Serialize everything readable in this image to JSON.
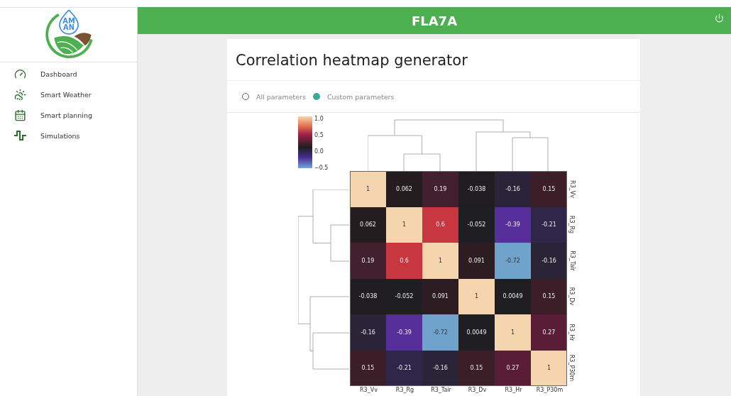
{
  "sidebar": {
    "logo": {
      "lines": [
        "AM",
        "AN"
      ]
    },
    "items": [
      {
        "label": "Dashboard"
      },
      {
        "label": "Smart Weather"
      },
      {
        "label": "Smart planning"
      },
      {
        "label": "Simulations"
      }
    ]
  },
  "header": {
    "title": "FLA7A"
  },
  "card": {
    "title": "Correlation heatmap generator",
    "options": [
      {
        "label": "All parameters",
        "selected": false
      },
      {
        "label": "Custom parameters",
        "selected": true
      }
    ],
    "heatmap": {
      "colorbar_ticks": [
        "1.0",
        "0.5",
        "0.0",
        "−0.5"
      ],
      "rows": [
        {
          "label": "R3_Vv",
          "cells": [
            {
              "text": "1",
              "color": "#f5d5ad"
            },
            {
              "text": "0.062",
              "color": "#241c1e"
            },
            {
              "text": "0.19",
              "color": "#43202e"
            },
            {
              "text": "-0.038",
              "color": "#1f1d22"
            },
            {
              "text": "-0.16",
              "color": "#2b2438"
            },
            {
              "text": "0.15",
              "color": "#3b1e27"
            }
          ]
        },
        {
          "label": "R3_Rg",
          "cells": [
            {
              "text": "0.062",
              "color": "#241c1e"
            },
            {
              "text": "1",
              "color": "#f5d5ad"
            },
            {
              "text": "0.6",
              "color": "#c8373f"
            },
            {
              "text": "-0.052",
              "color": "#1f1e23"
            },
            {
              "text": "-0.39",
              "color": "#572f9a"
            },
            {
              "text": "-0.21",
              "color": "#30264a"
            }
          ]
        },
        {
          "label": "R3_Tair",
          "cells": [
            {
              "text": "0.19",
              "color": "#43202e"
            },
            {
              "text": "0.6",
              "color": "#c8373f"
            },
            {
              "text": "1",
              "color": "#f5d5ad"
            },
            {
              "text": "0.091",
              "color": "#2d1d22"
            },
            {
              "text": "-0.72",
              "color": "#70a3cc"
            },
            {
              "text": "-0.16",
              "color": "#2b2438"
            }
          ]
        },
        {
          "label": "R3_Dv",
          "cells": [
            {
              "text": "-0.038",
              "color": "#1f1d22"
            },
            {
              "text": "-0.052",
              "color": "#1f1e23"
            },
            {
              "text": "0.091",
              "color": "#2d1d22"
            },
            {
              "text": "1",
              "color": "#f5d5ad"
            },
            {
              "text": "0.0049",
              "color": "#1f1e20"
            },
            {
              "text": "0.15",
              "color": "#3b1e27"
            }
          ]
        },
        {
          "label": "R3_Hr",
          "cells": [
            {
              "text": "-0.16",
              "color": "#2b2438"
            },
            {
              "text": "-0.39",
              "color": "#572f9a"
            },
            {
              "text": "-0.72",
              "color": "#70a3cc"
            },
            {
              "text": "0.0049",
              "color": "#1f1e20"
            },
            {
              "text": "1",
              "color": "#f5d5ad"
            },
            {
              "text": "0.27",
              "color": "#5a1d38"
            }
          ]
        },
        {
          "label": "R3_P30m",
          "cells": [
            {
              "text": "0.15",
              "color": "#3b1e27"
            },
            {
              "text": "-0.21",
              "color": "#30264a"
            },
            {
              "text": "-0.16",
              "color": "#2b2438"
            },
            {
              "text": "0.15",
              "color": "#3b1e27"
            },
            {
              "text": "0.27",
              "color": "#5a1d38"
            },
            {
              "text": "1",
              "color": "#f5d5ad"
            }
          ]
        }
      ],
      "bottom_labels": [
        "R3_Vv",
        "R3_Rg",
        "R3_Tair",
        "R3_Dv",
        "R3_Hr",
        "R3_P30m"
      ]
    }
  }
}
